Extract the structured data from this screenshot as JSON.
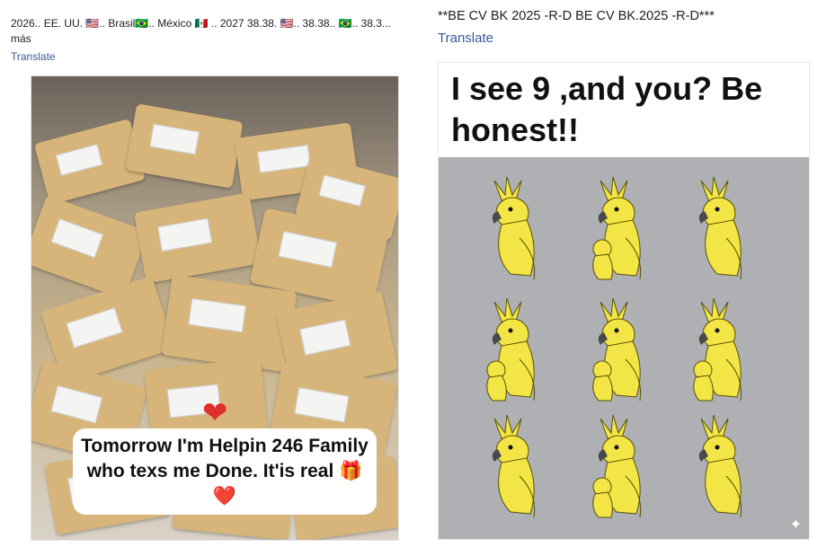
{
  "left_post": {
    "caption": "2026.. EE. UU. 🇺🇸.. Brasil🇧🇷.. México 🇲🇽 .. 2027 38.38. 🇺🇸.. 38.38.. 🇧🇷.. 38.3... más",
    "translate_label": "Translate",
    "image_text": "Tomorrow I'm Helpin 246 Family who texs me Done. It'is real 🎁❤️"
  },
  "right_post": {
    "caption": "**BE CV BK 2025 -R-D BE CV BK.2025 -R-D***",
    "translate_label": "Translate",
    "image_title": "I see 9 ,and you? Be honest!!"
  },
  "colors": {
    "link": "#385898",
    "bird_yellow": "#f2e545",
    "quiz_bg": "#aeb0b3"
  },
  "icons": {
    "heart": "heart-icon",
    "sparkle": "sparkle-icon"
  }
}
